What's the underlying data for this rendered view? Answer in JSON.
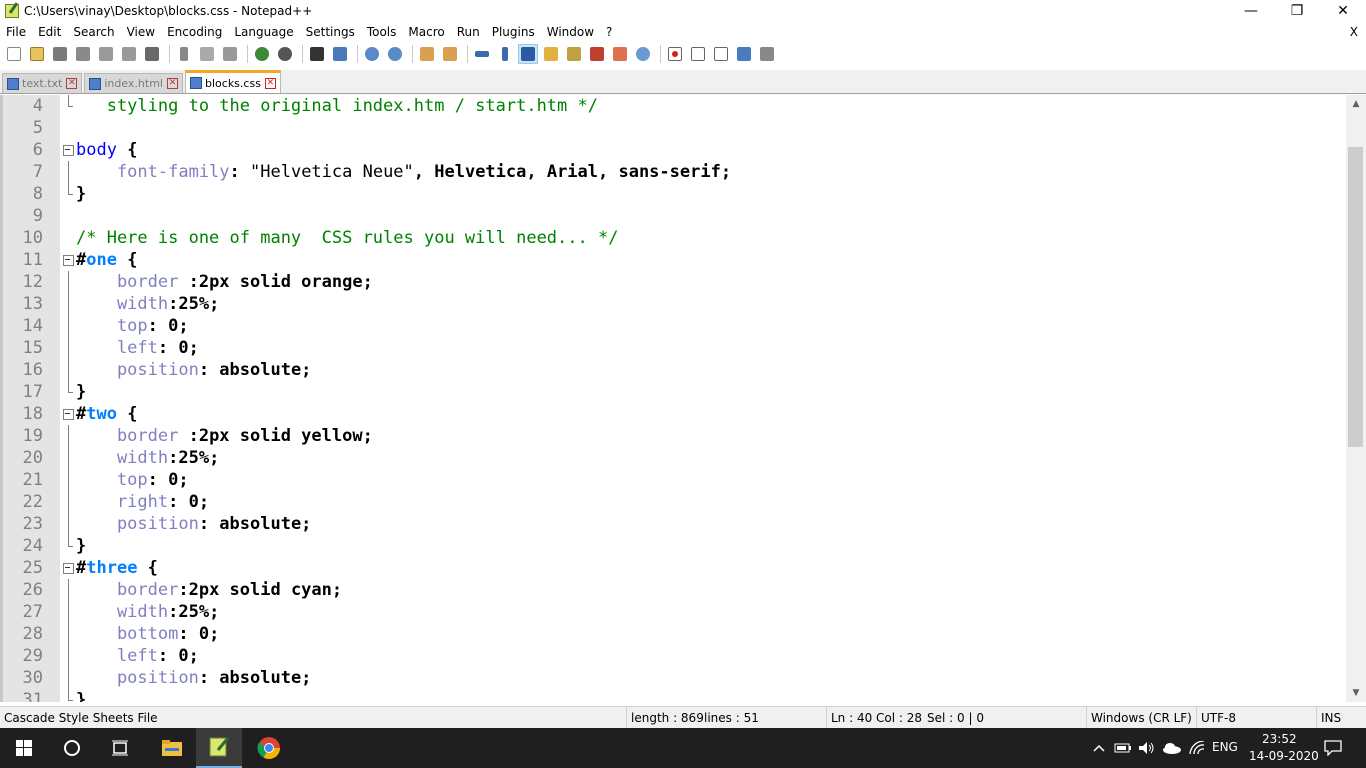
{
  "window": {
    "title": "C:\\Users\\vinay\\Desktop\\blocks.css - Notepad++",
    "minimize": "—",
    "maximize": "❐",
    "close": "✕"
  },
  "menu": {
    "items": [
      "File",
      "Edit",
      "Search",
      "View",
      "Encoding",
      "Language",
      "Settings",
      "Tools",
      "Macro",
      "Run",
      "Plugins",
      "Window",
      "?"
    ],
    "close_label": "X"
  },
  "toolbar": {
    "icons": [
      "new-file-icon",
      "open-file-icon",
      "save-icon",
      "save-all-icon",
      "close-icon",
      "close-all-icon",
      "print-icon",
      "cut-icon",
      "copy-icon",
      "paste-icon",
      "undo-icon",
      "redo-icon",
      "find-icon",
      "replace-icon",
      "zoom-in-icon",
      "zoom-out-icon",
      "sync-vertical-icon",
      "sync-horizontal-icon",
      "word-wrap-icon",
      "show-all-chars-icon",
      "indent-guide-icon",
      "udl-icon",
      "doc-map-icon",
      "function-list-icon",
      "folder-workspace-icon",
      "monitoring-icon",
      "record-macro-icon",
      "stop-macro-icon",
      "play-macro-icon",
      "run-macro-multiple-icon",
      "save-macro-icon"
    ]
  },
  "tabs": [
    {
      "label": "text.txt",
      "active": false
    },
    {
      "label": "index.html",
      "active": false
    },
    {
      "label": "blocks.css",
      "active": true
    }
  ],
  "editor": {
    "lines": [
      {
        "n": "4",
        "fold": "end",
        "segs": [
          {
            "t": "   styling to the original index.htm / start.htm */",
            "c": "c-com"
          }
        ]
      },
      {
        "n": "5",
        "fold": "",
        "segs": []
      },
      {
        "n": "6",
        "fold": "box",
        "segs": [
          {
            "t": "body",
            "c": "c-sel"
          },
          {
            "t": " {",
            "c": "c-op"
          }
        ]
      },
      {
        "n": "7",
        "fold": "mid",
        "segs": [
          {
            "t": "    font-family",
            "c": "c-prop"
          },
          {
            "t": ": ",
            "c": "c-op"
          },
          {
            "t": "\"Helvetica Neue\"",
            "c": "c-str"
          },
          {
            "t": ", Helvetica, Arial, sans-serif;",
            "c": "c-val"
          }
        ]
      },
      {
        "n": "8",
        "fold": "end",
        "segs": [
          {
            "t": "}",
            "c": "c-op"
          }
        ]
      },
      {
        "n": "9",
        "fold": "",
        "segs": []
      },
      {
        "n": "10",
        "fold": "",
        "segs": [
          {
            "t": "/* Here is one of many  CSS rules you will need... */",
            "c": "c-com"
          }
        ]
      },
      {
        "n": "11",
        "fold": "box",
        "segs": [
          {
            "t": "#",
            "c": "c-hash"
          },
          {
            "t": "one",
            "c": "c-id"
          },
          {
            "t": " {",
            "c": "c-op"
          }
        ]
      },
      {
        "n": "12",
        "fold": "mid",
        "segs": [
          {
            "t": "    border",
            "c": "c-prop"
          },
          {
            "t": " :2px solid orange;",
            "c": "c-val"
          }
        ]
      },
      {
        "n": "13",
        "fold": "mid",
        "segs": [
          {
            "t": "    width",
            "c": "c-prop"
          },
          {
            "t": ":25%;",
            "c": "c-val"
          }
        ]
      },
      {
        "n": "14",
        "fold": "mid",
        "segs": [
          {
            "t": "    top",
            "c": "c-prop"
          },
          {
            "t": ": 0;",
            "c": "c-val"
          }
        ]
      },
      {
        "n": "15",
        "fold": "mid",
        "segs": [
          {
            "t": "    left",
            "c": "c-prop"
          },
          {
            "t": ": 0;",
            "c": "c-val"
          }
        ]
      },
      {
        "n": "16",
        "fold": "mid",
        "segs": [
          {
            "t": "    position",
            "c": "c-prop"
          },
          {
            "t": ": absolute;",
            "c": "c-val"
          }
        ]
      },
      {
        "n": "17",
        "fold": "end",
        "segs": [
          {
            "t": "}",
            "c": "c-op"
          }
        ]
      },
      {
        "n": "18",
        "fold": "box",
        "segs": [
          {
            "t": "#",
            "c": "c-hash"
          },
          {
            "t": "two",
            "c": "c-id"
          },
          {
            "t": " {",
            "c": "c-op"
          }
        ]
      },
      {
        "n": "19",
        "fold": "mid",
        "segs": [
          {
            "t": "    border",
            "c": "c-prop"
          },
          {
            "t": " :2px solid yellow;",
            "c": "c-val"
          }
        ]
      },
      {
        "n": "20",
        "fold": "mid",
        "segs": [
          {
            "t": "    width",
            "c": "c-prop"
          },
          {
            "t": ":25%;",
            "c": "c-val"
          }
        ]
      },
      {
        "n": "21",
        "fold": "mid",
        "segs": [
          {
            "t": "    top",
            "c": "c-prop"
          },
          {
            "t": ": 0;",
            "c": "c-val"
          }
        ]
      },
      {
        "n": "22",
        "fold": "mid",
        "segs": [
          {
            "t": "    right",
            "c": "c-prop"
          },
          {
            "t": ": 0;",
            "c": "c-val"
          }
        ]
      },
      {
        "n": "23",
        "fold": "mid",
        "segs": [
          {
            "t": "    position",
            "c": "c-prop"
          },
          {
            "t": ": absolute;",
            "c": "c-val"
          }
        ]
      },
      {
        "n": "24",
        "fold": "end",
        "segs": [
          {
            "t": "}",
            "c": "c-op"
          }
        ]
      },
      {
        "n": "25",
        "fold": "box",
        "segs": [
          {
            "t": "#",
            "c": "c-hash"
          },
          {
            "t": "three",
            "c": "c-id"
          },
          {
            "t": " {",
            "c": "c-op"
          }
        ]
      },
      {
        "n": "26",
        "fold": "mid",
        "segs": [
          {
            "t": "    border",
            "c": "c-prop"
          },
          {
            "t": ":2px solid cyan;",
            "c": "c-val"
          }
        ]
      },
      {
        "n": "27",
        "fold": "mid",
        "segs": [
          {
            "t": "    width",
            "c": "c-prop"
          },
          {
            "t": ":25%;",
            "c": "c-val"
          }
        ]
      },
      {
        "n": "28",
        "fold": "mid",
        "segs": [
          {
            "t": "    bottom",
            "c": "c-prop"
          },
          {
            "t": ": 0;",
            "c": "c-val"
          }
        ]
      },
      {
        "n": "29",
        "fold": "mid",
        "segs": [
          {
            "t": "    left",
            "c": "c-prop"
          },
          {
            "t": ": 0;",
            "c": "c-val"
          }
        ]
      },
      {
        "n": "30",
        "fold": "mid",
        "segs": [
          {
            "t": "    position",
            "c": "c-prop"
          },
          {
            "t": ": absolute;",
            "c": "c-val"
          }
        ]
      },
      {
        "n": "31",
        "fold": "end",
        "segs": [
          {
            "t": "}",
            "c": "c-op"
          }
        ]
      }
    ]
  },
  "statusbar": {
    "file_type": "Cascade Style Sheets File",
    "length": "length : 869",
    "lines": "lines : 51",
    "ln": "Ln : 40",
    "col": "Col : 28",
    "sel": "Sel : 0 | 0",
    "eol": "Windows (CR LF)",
    "encoding": "UTF-8",
    "mode": "INS"
  },
  "taskbar": {
    "language": "ENG",
    "time": "23:52",
    "date": "14-09-2020"
  },
  "colors": {
    "comment": "#008000",
    "selector": "#0000ff",
    "id": "#0080ff",
    "property": "#8080c0",
    "tab_accent": "#f5a623"
  }
}
